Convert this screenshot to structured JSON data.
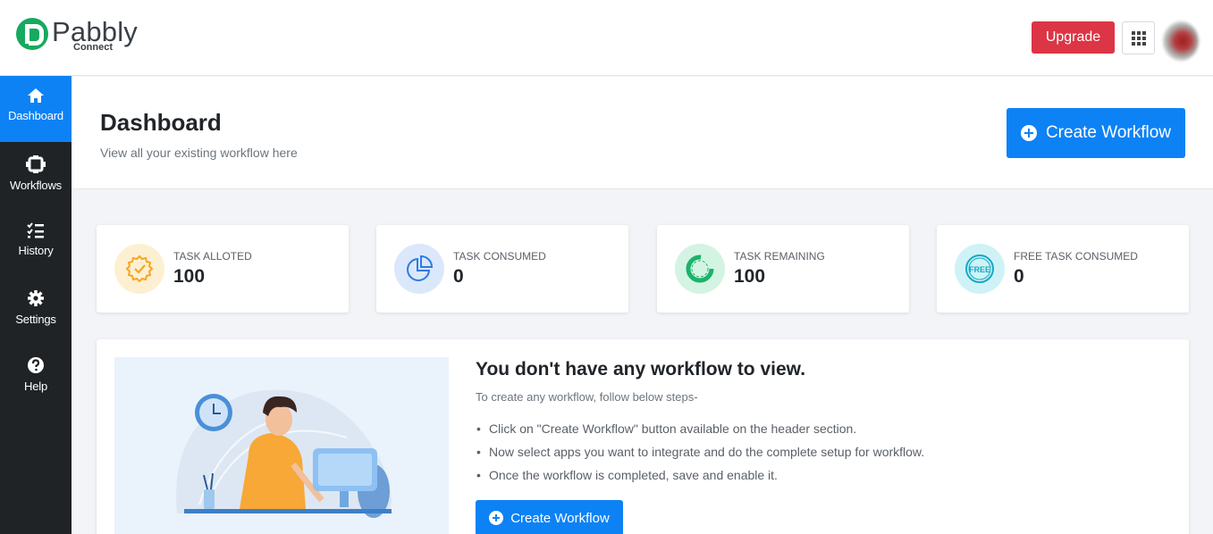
{
  "brand": {
    "name": "Pabbly",
    "product": "Connect"
  },
  "header": {
    "upgrade_label": "Upgrade"
  },
  "sidebar": {
    "items": [
      {
        "label": "Dashboard",
        "icon": "home-icon",
        "active": true
      },
      {
        "label": "Workflows",
        "icon": "workflow-icon",
        "active": false
      },
      {
        "label": "History",
        "icon": "history-list-icon",
        "active": false
      },
      {
        "label": "Settings",
        "icon": "gear-icon",
        "active": false
      },
      {
        "label": "Help",
        "icon": "help-icon",
        "active": false
      }
    ]
  },
  "page": {
    "title": "Dashboard",
    "subtitle": "View all your existing workflow here",
    "create_label": "Create Workflow"
  },
  "stats": [
    {
      "label": "TASK ALLOTED",
      "value": "100",
      "icon": "badge-check-icon",
      "color": "#f5a623"
    },
    {
      "label": "TASK CONSUMED",
      "value": "0",
      "icon": "pie-chart-icon",
      "color": "#2f7be0"
    },
    {
      "label": "TASK REMAINING",
      "value": "100",
      "icon": "progress-ring-icon",
      "color": "#1bb36a"
    },
    {
      "label": "FREE TASK CONSUMED",
      "value": "0",
      "icon": "free-badge-icon",
      "color": "#14a9c4"
    }
  ],
  "empty": {
    "title": "You don't have any workflow to view.",
    "subtitle": "To create any workflow, follow below steps-",
    "steps": [
      "Click on \"Create Workflow\" button available on the header section.",
      "Now select apps you want to integrate and do the complete setup for workflow.",
      "Once the workflow is completed, save and enable it."
    ],
    "create_label": "Create Workflow"
  },
  "colors": {
    "primary": "#0d82f5",
    "danger": "#dc3545",
    "sidebar": "#1f2326"
  }
}
